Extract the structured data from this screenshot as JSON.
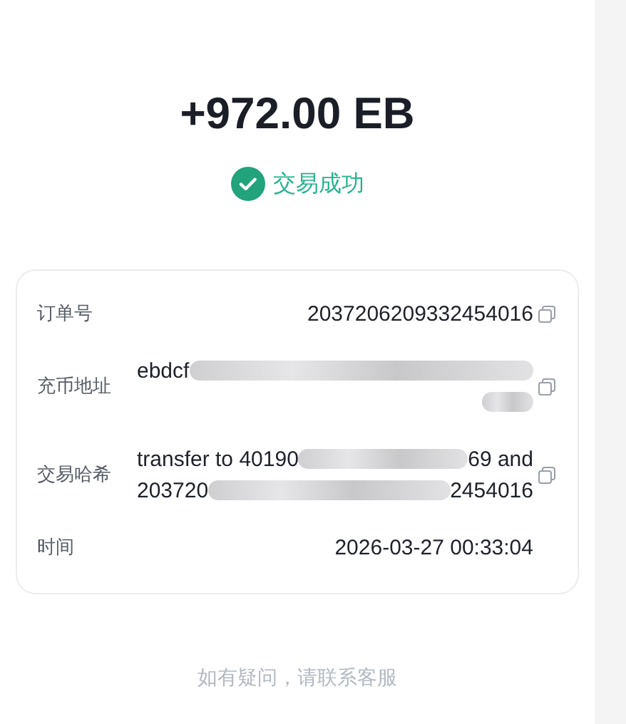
{
  "amount": "+972.00 EB",
  "status": {
    "label": "交易成功",
    "kind": "success"
  },
  "details": [
    {
      "label": "订单号",
      "copyable": true,
      "lines": [
        [
          {
            "kind": "text",
            "text": "2037206209332454016"
          }
        ]
      ]
    },
    {
      "label": "充币地址",
      "copyable": true,
      "lines": [
        [
          {
            "kind": "text",
            "text": "ebdcf"
          },
          {
            "kind": "redacted"
          }
        ],
        [
          {
            "kind": "redacted"
          }
        ]
      ]
    },
    {
      "label": "交易哈希",
      "copyable": true,
      "lines": [
        [
          {
            "kind": "text",
            "text": "transfer to 40190"
          },
          {
            "kind": "redacted"
          },
          {
            "kind": "text",
            "text": "69 and"
          }
        ],
        [
          {
            "kind": "text",
            "text": "203720"
          },
          {
            "kind": "redacted"
          },
          {
            "kind": "text",
            "text": "2454016"
          }
        ]
      ]
    },
    {
      "label": "时间",
      "copyable": false,
      "lines": [
        [
          {
            "kind": "text",
            "text": "2026-03-27 00:33:04"
          }
        ]
      ]
    }
  ],
  "footer": "如有疑问，请联系客服"
}
